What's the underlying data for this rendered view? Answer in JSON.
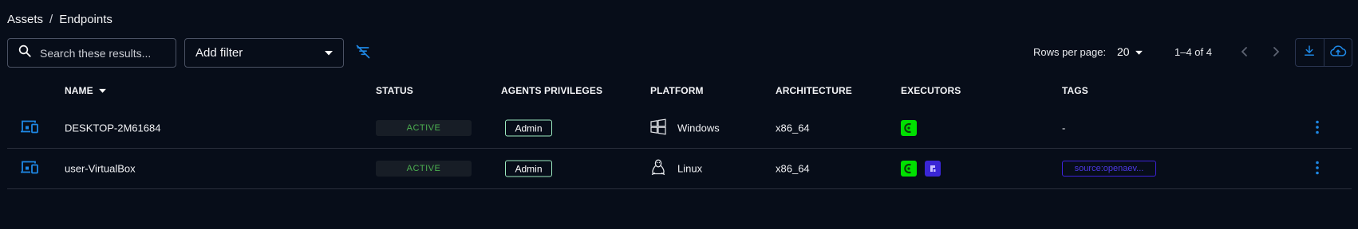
{
  "breadcrumb": {
    "parent": "Assets",
    "separator": "/",
    "current": "Endpoints"
  },
  "toolbar": {
    "search_placeholder": "Search these results...",
    "filter_label": "Add filter",
    "rows_per_page_label": "Rows per page:",
    "rows_per_page_value": "20",
    "range_text": "1–4 of 4"
  },
  "table": {
    "headers": {
      "name": "NAME",
      "status": "STATUS",
      "privileges": "AGENTS PRIVILEGES",
      "platform": "PLATFORM",
      "architecture": "ARCHITECTURE",
      "executors": "EXECUTORS",
      "tags": "TAGS"
    },
    "rows": [
      {
        "name": "DESKTOP-2M61684",
        "status": "ACTIVE",
        "privileges": "Admin",
        "platform": "Windows",
        "platform_icon": "windows-icon",
        "architecture": "x86_64",
        "executors": [
          "openaev-agent-icon"
        ],
        "tags": "-"
      },
      {
        "name": "user-VirtualBox",
        "status": "ACTIVE",
        "privileges": "Admin",
        "platform": "Linux",
        "platform_icon": "linux-icon",
        "architecture": "x86_64",
        "executors": [
          "openaev-agent-icon",
          "caldera-icon"
        ],
        "tags": "source:openaev..."
      }
    ]
  },
  "colors": {
    "background": "#070d19",
    "accent": "#1e88e5",
    "status_active": "#4caf50",
    "executor_green": "#00e000",
    "executor_purple": "#3a26d6",
    "tag": "#4d38e6"
  }
}
